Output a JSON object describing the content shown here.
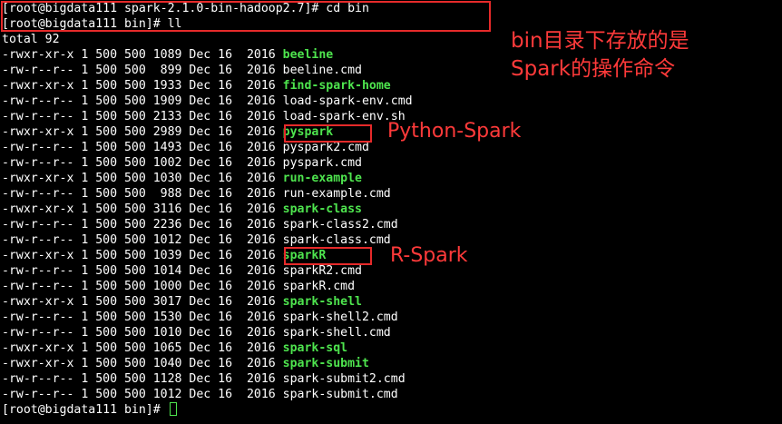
{
  "terminal": {
    "prompt_lines": [
      "[root@bigdata111 spark-2.1.0-bin-hadoop2.7]# cd bin",
      "[root@bigdata111 bin]# ll"
    ],
    "total": "total 92",
    "files": [
      {
        "meta": "-rwxr-xr-x 1 500 500 1089 Dec 16  2016 ",
        "name": "beeline",
        "exec": true
      },
      {
        "meta": "-rw-r--r-- 1 500 500  899 Dec 16  2016 ",
        "name": "beeline.cmd",
        "exec": false
      },
      {
        "meta": "-rwxr-xr-x 1 500 500 1933 Dec 16  2016 ",
        "name": "find-spark-home",
        "exec": true
      },
      {
        "meta": "-rw-r--r-- 1 500 500 1909 Dec 16  2016 ",
        "name": "load-spark-env.cmd",
        "exec": false
      },
      {
        "meta": "-rw-r--r-- 1 500 500 2133 Dec 16  2016 ",
        "name": "load-spark-env.sh",
        "exec": false
      },
      {
        "meta": "-rwxr-xr-x 1 500 500 2989 Dec 16  2016 ",
        "name": "pyspark",
        "exec": true
      },
      {
        "meta": "-rw-r--r-- 1 500 500 1493 Dec 16  2016 ",
        "name": "pyspark2.cmd",
        "exec": false
      },
      {
        "meta": "-rw-r--r-- 1 500 500 1002 Dec 16  2016 ",
        "name": "pyspark.cmd",
        "exec": false
      },
      {
        "meta": "-rwxr-xr-x 1 500 500 1030 Dec 16  2016 ",
        "name": "run-example",
        "exec": true
      },
      {
        "meta": "-rw-r--r-- 1 500 500  988 Dec 16  2016 ",
        "name": "run-example.cmd",
        "exec": false
      },
      {
        "meta": "-rwxr-xr-x 1 500 500 3116 Dec 16  2016 ",
        "name": "spark-class",
        "exec": true
      },
      {
        "meta": "-rw-r--r-- 1 500 500 2236 Dec 16  2016 ",
        "name": "spark-class2.cmd",
        "exec": false
      },
      {
        "meta": "-rw-r--r-- 1 500 500 1012 Dec 16  2016 ",
        "name": "spark-class.cmd",
        "exec": false
      },
      {
        "meta": "-rwxr-xr-x 1 500 500 1039 Dec 16  2016 ",
        "name": "sparkR",
        "exec": true
      },
      {
        "meta": "-rw-r--r-- 1 500 500 1014 Dec 16  2016 ",
        "name": "sparkR2.cmd",
        "exec": false
      },
      {
        "meta": "-rw-r--r-- 1 500 500 1000 Dec 16  2016 ",
        "name": "sparkR.cmd",
        "exec": false
      },
      {
        "meta": "-rwxr-xr-x 1 500 500 3017 Dec 16  2016 ",
        "name": "spark-shell",
        "exec": true
      },
      {
        "meta": "-rw-r--r-- 1 500 500 1530 Dec 16  2016 ",
        "name": "spark-shell2.cmd",
        "exec": false
      },
      {
        "meta": "-rw-r--r-- 1 500 500 1010 Dec 16  2016 ",
        "name": "spark-shell.cmd",
        "exec": false
      },
      {
        "meta": "-rwxr-xr-x 1 500 500 1065 Dec 16  2016 ",
        "name": "spark-sql",
        "exec": true
      },
      {
        "meta": "-rwxr-xr-x 1 500 500 1040 Dec 16  2016 ",
        "name": "spark-submit",
        "exec": true
      },
      {
        "meta": "-rw-r--r-- 1 500 500 1128 Dec 16  2016 ",
        "name": "spark-submit2.cmd",
        "exec": false
      },
      {
        "meta": "-rw-r--r-- 1 500 500 1012 Dec 16  2016 ",
        "name": "spark-submit.cmd",
        "exec": false
      }
    ],
    "final_prompt": "[root@bigdata111 bin]# "
  },
  "annotations": {
    "bin_note_line1": "bin目录下存放的是",
    "bin_note_line2": "Spark的操作命令",
    "python_label": "Python-Spark",
    "r_label": "R-Spark"
  },
  "colors": {
    "background": "#000000",
    "text": "#ffffff",
    "executable": "#4ee44e",
    "annotation": "#ff3a3a",
    "highlight_box": "#e62a2a"
  }
}
